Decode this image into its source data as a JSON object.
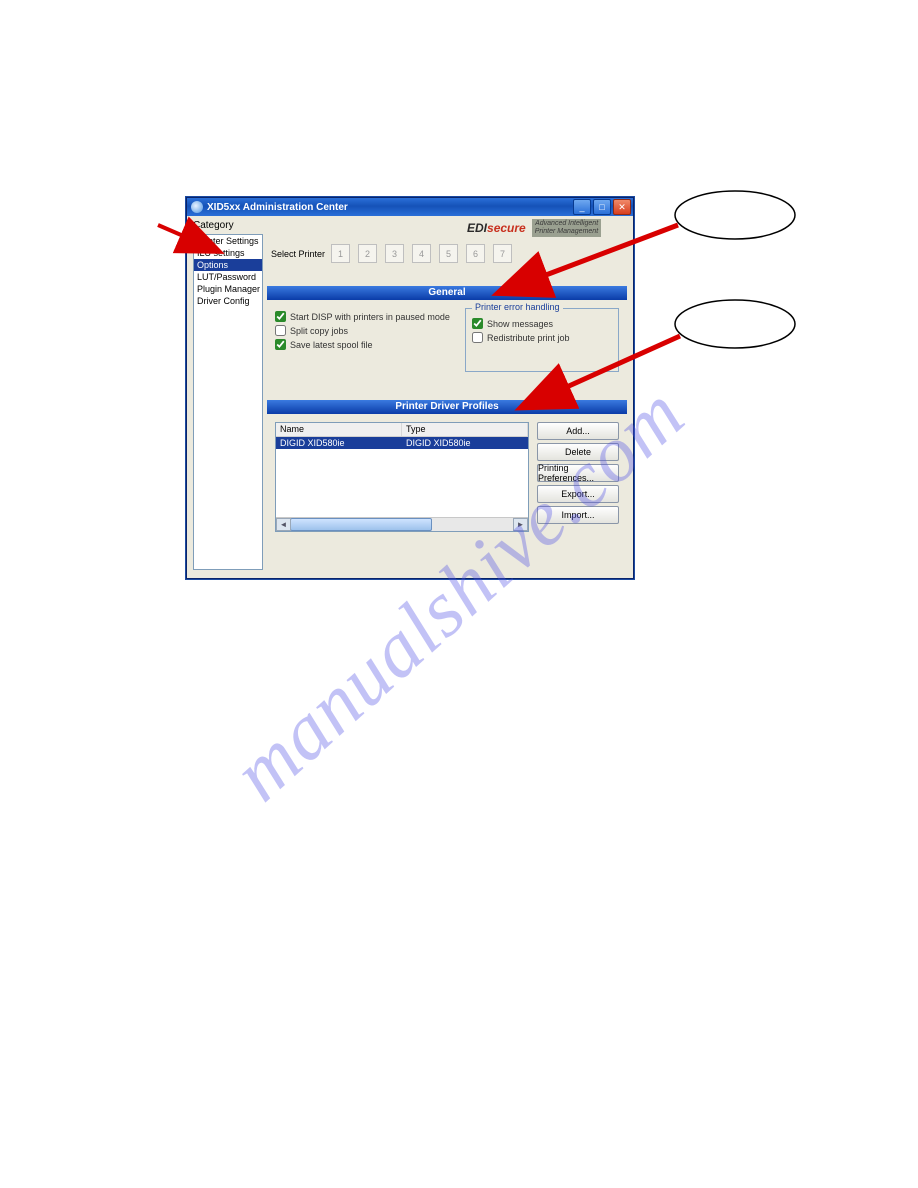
{
  "watermark": "manualshive.com",
  "titlebar": {
    "title": "XID5xx Administration Center"
  },
  "brand": {
    "edi": "EDI",
    "secure": "secure",
    "tag_line1": "Advanced Intelligent",
    "tag_line2": "Printer Management"
  },
  "sidebar": {
    "label": "Category",
    "items": [
      {
        "label": "Printer Settings"
      },
      {
        "label": "ILU settings"
      },
      {
        "label": "Options",
        "selected": true
      },
      {
        "label": "LUT/Password"
      },
      {
        "label": "Plugin Manager"
      },
      {
        "label": "Driver Config"
      }
    ]
  },
  "select_printer": {
    "label": "Select Printer",
    "buttons": [
      "1",
      "2",
      "3",
      "4",
      "5",
      "6",
      "7"
    ]
  },
  "general": {
    "header": "General",
    "start_disp": {
      "label": "Start DISP with printers in paused mode",
      "checked": true
    },
    "split_copy": {
      "label": "Split copy jobs",
      "checked": false
    },
    "save_spool": {
      "label": "Save latest spool file",
      "checked": true
    },
    "error_group": {
      "legend": "Printer error handling",
      "show_messages": {
        "label": "Show messages",
        "checked": true
      },
      "redistribute": {
        "label": "Redistribute print job",
        "checked": false
      }
    }
  },
  "profiles": {
    "header": "Printer Driver Profiles",
    "columns": [
      "Name",
      "Type"
    ],
    "rows": [
      {
        "name": "DIGID XID580ie",
        "type": "DIGID XID580ie"
      }
    ],
    "buttons": {
      "add": "Add...",
      "delete": "Delete",
      "prefs": "Printing Preferences...",
      "export": "Export...",
      "import": "Import..."
    }
  }
}
